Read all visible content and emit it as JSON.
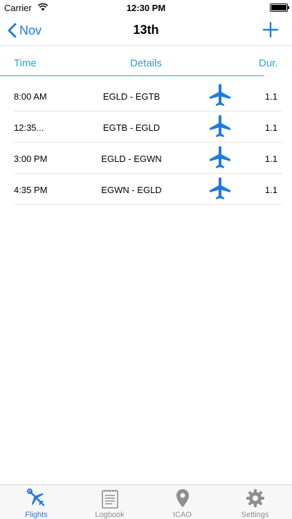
{
  "status_bar": {
    "carrier": "Carrier",
    "time": "12:30 PM"
  },
  "nav": {
    "back_label": "Nov",
    "title": "13th"
  },
  "columns": {
    "time": "Time",
    "details": "Details",
    "duration": "Dur."
  },
  "flights": [
    {
      "time": "8:00 AM",
      "route": "EGLD - EGTB",
      "duration": "1.1",
      "icon": "airplane-icon"
    },
    {
      "time": "12:35...",
      "route": "EGTB - EGLD",
      "duration": "1.1",
      "icon": "airplane-icon"
    },
    {
      "time": "3:00 PM",
      "route": "EGLD - EGWN",
      "duration": "1.1",
      "icon": "airplane-icon"
    },
    {
      "time": "4:35 PM",
      "route": "EGWN - EGLD",
      "duration": "1.1",
      "icon": "airplane-icon"
    }
  ],
  "tabs": [
    {
      "label": "Flights",
      "icon": "airplane-wrench-icon",
      "active": true
    },
    {
      "label": "Logbook",
      "icon": "logbook-icon",
      "active": false
    },
    {
      "label": "ICAO",
      "icon": "location-pin-icon",
      "active": false
    },
    {
      "label": "Settings",
      "icon": "gear-icon",
      "active": false
    }
  ],
  "colors": {
    "accent": "#1f7ae0",
    "header": "#27a3d9",
    "inactive": "#8e8e93"
  }
}
